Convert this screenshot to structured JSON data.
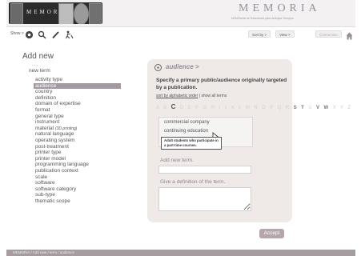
{
  "header": {
    "logo_word": "MEMORIA",
    "brand": "MEMORIA",
    "brand_sub": "DEMOtorial de Relaciones para Anticipar Tiempos"
  },
  "toolbar": {
    "show_label": "Show",
    "sort_label": "Sort by",
    "view_label": "View",
    "connection_label": "Connection",
    "icons": [
      "settings-icon",
      "search-icon",
      "pencil-icon",
      "person-icon",
      "home-icon"
    ]
  },
  "left": {
    "title": "Add new",
    "dots": "...",
    "new_term": "new term",
    "items": [
      "activity type",
      "audience",
      "country",
      "definition",
      "domain of expertise",
      "format",
      "general type",
      "instrument",
      "material",
      "natural language",
      "operating system",
      "post-treatment",
      "printer type",
      "printer model",
      "programming language",
      "publication context",
      "scale",
      "software",
      "software  category",
      "sub-type",
      "thematic scope"
    ],
    "material_note": "(3D printing)",
    "selected_index": 1
  },
  "panel": {
    "title": "audience >",
    "prompt": "Specify a primary public/audience originally targeted by a publication.",
    "sort_alpha": "sort by alphabetic order",
    "separator": "|",
    "show_all": "show all terms",
    "alphabet_prefix": "A B",
    "alphabet_active": "C",
    "alphabet_mid1": "D E F G H I J K L M N O P Q R",
    "alphabet_s": "S",
    "alphabet_t": "T",
    "alphabet_u": "U",
    "alphabet_v": "V",
    "alphabet_w": "W",
    "alphabet_rest": "X Y Z",
    "results": [
      "commercial company",
      "continuing education"
    ],
    "tooltip": "Adult students who participate in a part-time courses.",
    "add_term_label": "Add new term.",
    "definition_label": "Give a definition of the term.",
    "accept": "Accept"
  },
  "footer": {
    "text": "MEMORIA / Add new / term / audience"
  }
}
